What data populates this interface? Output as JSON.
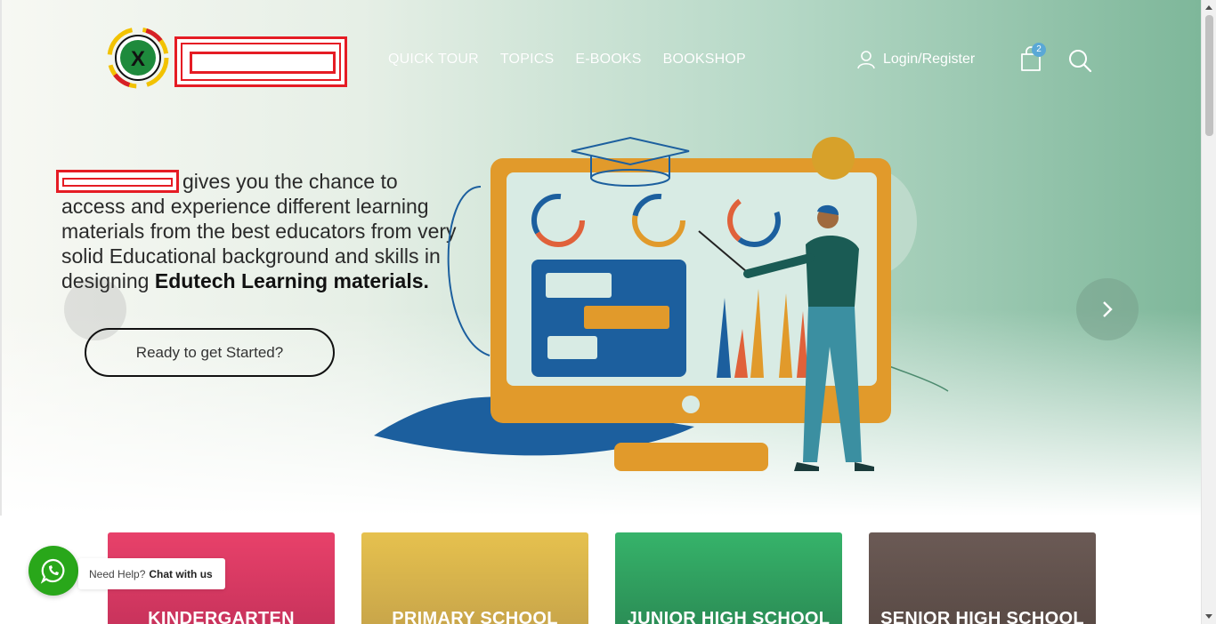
{
  "nav": {
    "items": [
      "QUICK TOUR",
      "TOPICS",
      "E-BOOKS",
      "BOOKSHOP"
    ],
    "login_label": "Login/Register",
    "cart_count": "2"
  },
  "hero": {
    "text_line": "gives you the chance to access and experience different learning materials from the best educators from very solid Educational background and skills in designing",
    "text_bold": "Edutech Learning materials.",
    "cta_label": "Ready to get Started?"
  },
  "cards": [
    {
      "label": "KINDERGARTEN",
      "color": "#e8416a"
    },
    {
      "label": "PRIMARY SCHOOL",
      "color": "#e6c14e"
    },
    {
      "label": "JUNIOR HIGH SCHOOL",
      "color": "#36b36a"
    },
    {
      "label": "SENIOR HIGH SCHOOL",
      "color": "#6b5a55"
    }
  ],
  "chat": {
    "prefix": "Need Help?",
    "link": "Chat with us"
  },
  "colors": {
    "accent_red": "#e51c24",
    "whatsapp_green": "#29a71a",
    "badge_blue": "#5aa8d6"
  }
}
